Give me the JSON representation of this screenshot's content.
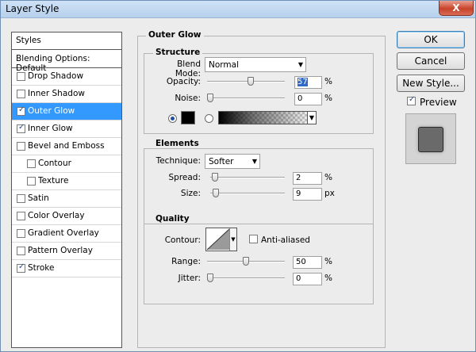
{
  "window": {
    "title": "Layer Style",
    "close_glyph": "X"
  },
  "styles_list": {
    "header": "Styles",
    "blending_options": "Blending Options: Default",
    "items": [
      {
        "label": "Drop Shadow",
        "checked": false,
        "selected": false,
        "indent": false
      },
      {
        "label": "Inner Shadow",
        "checked": false,
        "selected": false,
        "indent": false
      },
      {
        "label": "Outer Glow",
        "checked": true,
        "selected": true,
        "indent": false
      },
      {
        "label": "Inner Glow",
        "checked": true,
        "selected": false,
        "indent": false
      },
      {
        "label": "Bevel and Emboss",
        "checked": false,
        "selected": false,
        "indent": false
      },
      {
        "label": "Contour",
        "checked": false,
        "selected": false,
        "indent": true
      },
      {
        "label": "Texture",
        "checked": false,
        "selected": false,
        "indent": true
      },
      {
        "label": "Satin",
        "checked": false,
        "selected": false,
        "indent": false
      },
      {
        "label": "Color Overlay",
        "checked": false,
        "selected": false,
        "indent": false
      },
      {
        "label": "Gradient Overlay",
        "checked": false,
        "selected": false,
        "indent": false
      },
      {
        "label": "Pattern Overlay",
        "checked": false,
        "selected": false,
        "indent": false
      },
      {
        "label": "Stroke",
        "checked": true,
        "selected": false,
        "indent": false
      }
    ]
  },
  "outer_glow": {
    "title": "Outer Glow",
    "structure": {
      "title": "Structure",
      "blend_mode_label": "Blend Mode:",
      "blend_mode_value": "Normal",
      "opacity_label": "Opacity:",
      "opacity_value": "57",
      "opacity_unit": "%",
      "opacity_fraction": 0.57,
      "noise_label": "Noise:",
      "noise_value": "0",
      "noise_unit": "%",
      "noise_fraction": 0,
      "color_mode": "solid",
      "glow_color": "#000000"
    },
    "elements": {
      "title": "Elements",
      "technique_label": "Technique:",
      "technique_value": "Softer",
      "spread_label": "Spread:",
      "spread_value": "2",
      "spread_unit": "%",
      "spread_fraction": 0.02,
      "size_label": "Size:",
      "size_value": "9",
      "size_unit": "px",
      "size_fraction": 0.04
    },
    "quality": {
      "title": "Quality",
      "contour_label": "Contour:",
      "anti_aliased_label": "Anti-aliased",
      "anti_aliased": false,
      "range_label": "Range:",
      "range_value": "50",
      "range_unit": "%",
      "range_fraction": 0.5,
      "jitter_label": "Jitter:",
      "jitter_value": "0",
      "jitter_unit": "%",
      "jitter_fraction": 0
    }
  },
  "buttons": {
    "ok": "OK",
    "cancel": "Cancel",
    "new_style": "New Style..."
  },
  "preview": {
    "label": "Preview",
    "checked": true
  },
  "colors": {
    "selection": "#3399ff",
    "field_highlight": "#316ac5"
  }
}
